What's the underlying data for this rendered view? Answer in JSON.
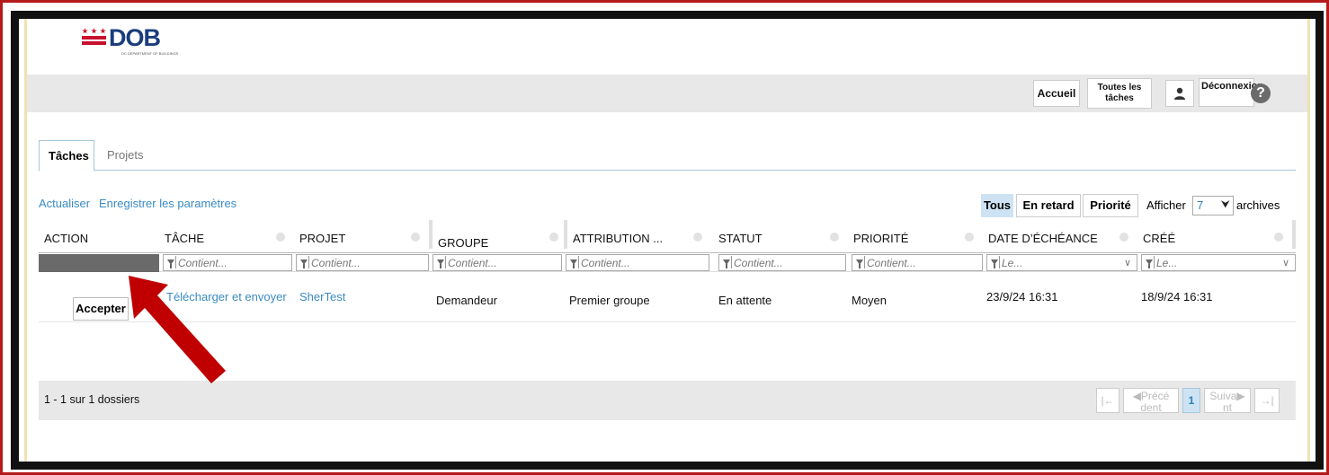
{
  "brand": {
    "logo_text": "DOB",
    "logo_subtext": "DC DEPARTMENT OF BUILDINGS"
  },
  "topnav": {
    "home": "Accueil",
    "all_tasks": "Toutes les tâches",
    "logout": "Déconnexion",
    "help": "?"
  },
  "tabs": [
    {
      "label": "Tâches",
      "active": true
    },
    {
      "label": "Projets",
      "active": false
    }
  ],
  "toolbar": {
    "refresh": "Actualiser",
    "save_settings": "Enregistrer les paramètres",
    "filters": [
      {
        "label": "Tous",
        "selected": true
      },
      {
        "label": "En retard",
        "selected": false
      },
      {
        "label": "Priorité",
        "selected": false
      }
    ],
    "show_label": "Afficher",
    "show_value": "7",
    "records_label": "archives"
  },
  "columns": [
    "ACTION",
    "TÂCHE",
    "PROJET",
    "GROUPE",
    "ATTRIBUTION ...",
    "STATUT",
    "PRIORITÉ",
    "DATE D’ÉCHÉANCE",
    "CRÉÉ"
  ],
  "filters": {
    "contains": "Contient...",
    "date": "Le..."
  },
  "rows": [
    {
      "action": "Accepter",
      "task": "Télécharger et envoyer",
      "project": "SherTest",
      "group": "Demandeur",
      "assignment": "Premier groupe",
      "status": "En attente",
      "priority": "Moyen",
      "due": "23/9/24 16:31",
      "created": "18/9/24 16:31"
    }
  ],
  "pager": {
    "info": "1 - 1 sur 1 dossiers",
    "first": "|←",
    "prev": "◀Précé dent",
    "page": "1",
    "next": "Suiva▶ nt",
    "last": "→|"
  },
  "annotation": {
    "arrow_color": "#c00000"
  }
}
